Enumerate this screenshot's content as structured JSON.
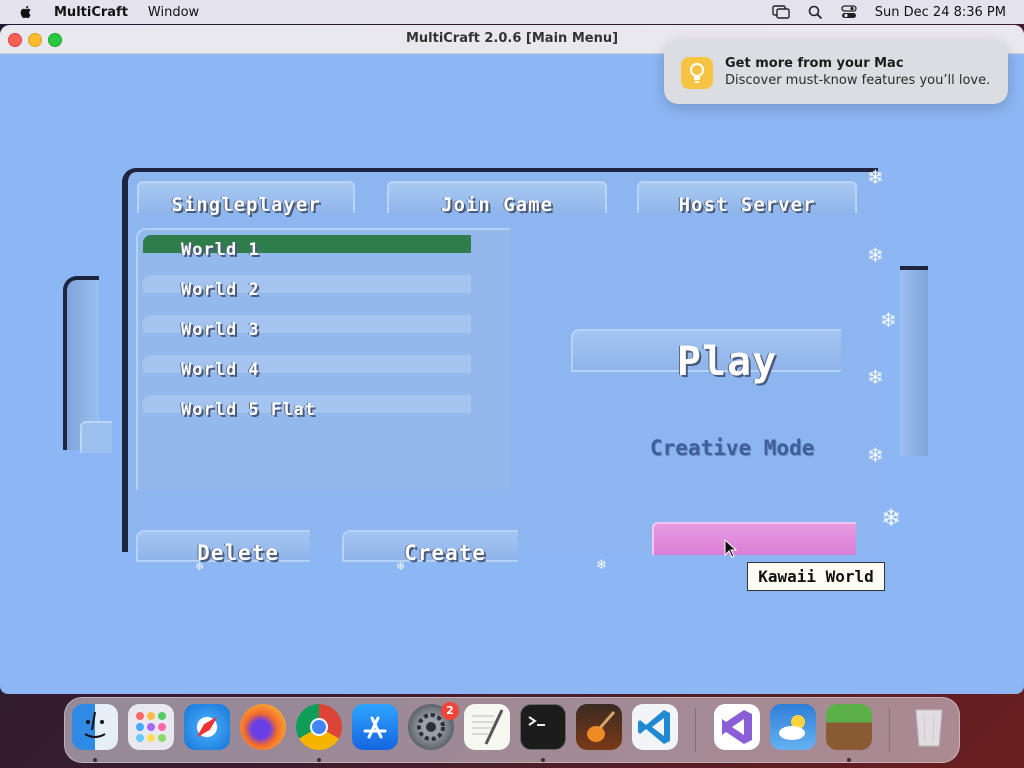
{
  "menubar": {
    "app_name": "MultiCraft",
    "menu_window": "Window",
    "clock": "Sun Dec 24  8:36 PM"
  },
  "window": {
    "title": "MultiCraft 2.0.6 [Main Menu]"
  },
  "notification": {
    "title": "Get more from your Mac",
    "body": "Discover must-know features you’ll love."
  },
  "game": {
    "tabs": [
      {
        "label": "Singleplayer",
        "selected": true
      },
      {
        "label": "Join Game"
      },
      {
        "label": "Host Server"
      }
    ],
    "worlds": [
      {
        "label": "World 1",
        "selected": true
      },
      {
        "label": "World 2"
      },
      {
        "label": "World 3"
      },
      {
        "label": "World 4"
      },
      {
        "label": "World 5 Flat"
      }
    ],
    "play_label": "Play",
    "mode_label": "Creative Mode",
    "delete_label": "Delete",
    "create_label": "Create",
    "tooltip": "Kawaii World",
    "colors": {
      "background": "#8db6f4",
      "selected_world": "#2e7d4a",
      "pink_button": "#e08ad9"
    }
  },
  "dock": {
    "apps": [
      {
        "name": "finder-icon",
        "running": true
      },
      {
        "name": "launchpad-icon"
      },
      {
        "name": "safari-icon"
      },
      {
        "name": "firefox-icon"
      },
      {
        "name": "chrome-icon",
        "running": true
      },
      {
        "name": "app-store-icon"
      },
      {
        "name": "system-settings-icon",
        "badge": "2"
      },
      {
        "name": "textedit-icon"
      },
      {
        "name": "terminal-icon",
        "running": true
      },
      {
        "name": "garageband-icon"
      },
      {
        "name": "vscode-icon"
      },
      {
        "name": "visual-studio-icon"
      },
      {
        "name": "weather-icon"
      },
      {
        "name": "multicraft-icon",
        "running": true
      },
      {
        "name": "trash-icon"
      }
    ]
  }
}
